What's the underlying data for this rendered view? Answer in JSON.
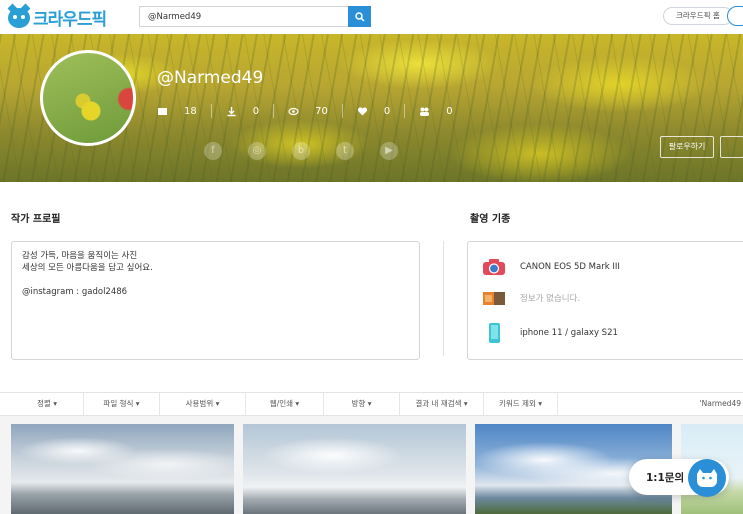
{
  "header": {
    "logo_text": "크라우드픽",
    "search_value": "@Narmed49",
    "home_button": "크라우드픽 홈"
  },
  "banner": {
    "username": "@Narmed49",
    "stats": [
      {
        "icon": "photos-icon",
        "value": "18"
      },
      {
        "icon": "download-icon",
        "value": "0"
      },
      {
        "icon": "eye-icon",
        "value": "70"
      },
      {
        "icon": "heart-icon",
        "value": "0"
      },
      {
        "icon": "followers-icon",
        "value": "0"
      }
    ],
    "follow_button": "팔로우하기"
  },
  "profile": {
    "title": "작가 프로필",
    "lines": [
      "감성 가득, 마음을 움직이는 사진",
      "세상의 모든 아름다움을 담고 싶어요.",
      "",
      "@instagram : gadol2486"
    ]
  },
  "gear": {
    "title": "촬영 기종",
    "camera": "CANON EOS 5D Mark III",
    "lens": "정보가 없습니다.",
    "phone": "iphone 11 / galaxy S21"
  },
  "filters": {
    "items": [
      "정렬 ▾",
      "파일 형식 ▾",
      "사용범위 ▾",
      "웹/인쇄 ▾",
      "방향 ▾",
      "결과 내 재검색 ▾",
      "키워드 제외 ▾"
    ],
    "trail": "'Narmed49"
  },
  "chat": {
    "label": "1:1문의"
  },
  "colors": {
    "accent": "#2a8fd6",
    "banner": "#c8b62a"
  }
}
